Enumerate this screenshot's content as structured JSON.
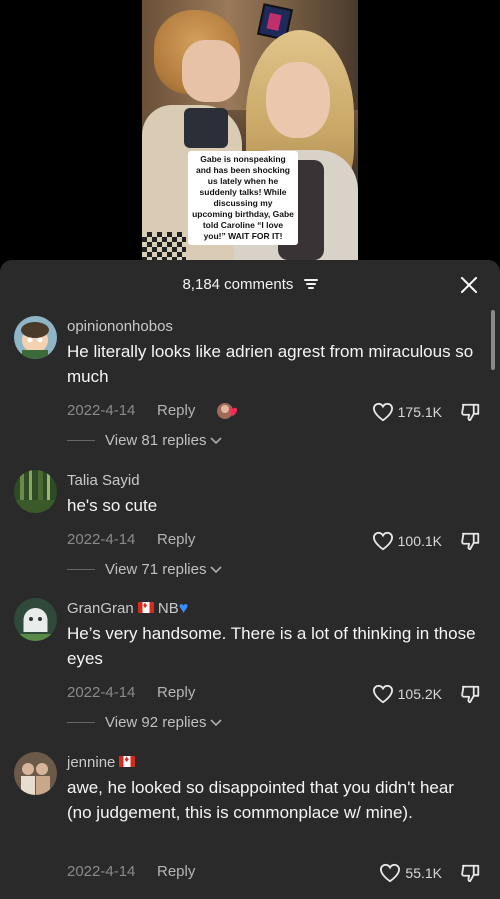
{
  "video": {
    "caption": "Gabe is nonspeaking and has been shocking us lately when he suddenly talks! While discussing my upcoming birthday, Gabe told Caroline “I love you!” WAIT FOR IT!"
  },
  "header": {
    "comment_count": "8,184 comments",
    "filter_icon": "sort-lines-icon",
    "close_icon": "close-icon"
  },
  "comments": [
    {
      "username": "opiniononhobos",
      "text": "He literally looks like adrien agrest from miraculous so much",
      "date": "2022-4-14",
      "reply_label": "Reply",
      "likes": "175.1K",
      "view_replies": "View 81 replies",
      "avatar_color": "#8fb5c7"
    },
    {
      "username": "Talia Sayid",
      "text": "he's so cute",
      "date": "2022-4-14",
      "reply_label": "Reply",
      "likes": "100.1K",
      "view_replies": "View 71 replies",
      "avatar_color": "#3f5a2c"
    },
    {
      "username": "GranGran",
      "username_suffix": "NB",
      "text": "He’s very handsome. There is a lot of thinking in those eyes",
      "date": "2022-4-14",
      "reply_label": "Reply",
      "likes": "105.2K",
      "view_replies": "View 92 replies",
      "avatar_color": "#2f4a3a"
    },
    {
      "username": "jennine",
      "text": "awe, he looked so disappointed that you didn't hear (no judgement, this is commonplace w/ mine).",
      "date": "2022-4-14",
      "reply_label": "Reply",
      "likes": "55.1K",
      "avatar_color": "#6b5a4a"
    }
  ]
}
